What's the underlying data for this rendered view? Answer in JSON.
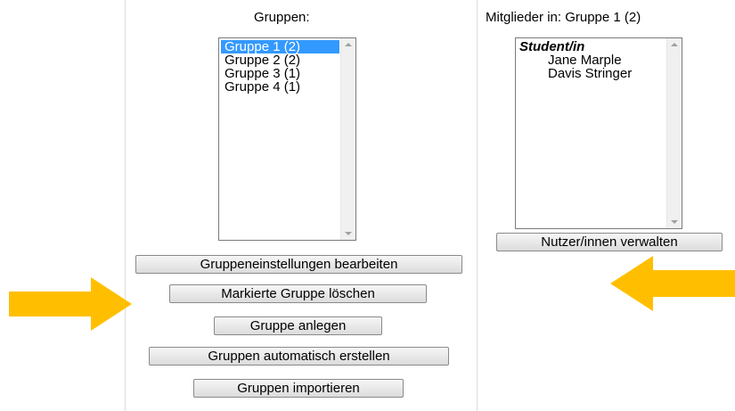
{
  "groups_panel": {
    "heading": "Gruppen:",
    "groups": [
      "Gruppe 1 (2)",
      "Gruppe 2 (2)",
      "Gruppe 3 (1)",
      "Gruppe 4 (1)"
    ],
    "selected_index": 0
  },
  "members_panel": {
    "heading": "Mitglieder in: Gruppe 1 (2)",
    "role_label": "Student/in",
    "members": [
      "Jane Marple",
      "Davis Stringer"
    ]
  },
  "buttons": {
    "edit_group_settings": "Gruppeneinstellungen bearbeiten",
    "delete_selected_group": "Markierte Gruppe löschen",
    "create_group": "Gruppe anlegen",
    "auto_create_groups": "Gruppen automatisch erstellen",
    "import_groups": "Gruppen importieren",
    "manage_users": "Nutzer/innen verwalten"
  },
  "annotations": {
    "arrow_color": "#ffbf00"
  }
}
